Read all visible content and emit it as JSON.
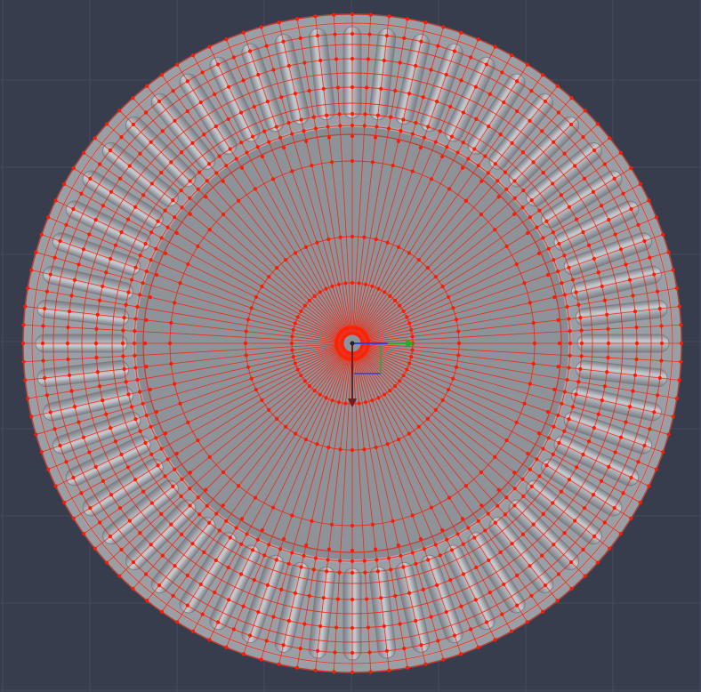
{
  "viewport": {
    "view": "top",
    "background_color": "#373d4d",
    "grid_line_color": "#454c5d"
  },
  "model": {
    "object": "plate",
    "surface_color": "#8e9299",
    "rim_color": "#9a9ea5",
    "flute_highlight_color": "#c9ccd1",
    "flute_count": 56,
    "radial_segment_count": 112,
    "wireframe_color": "#ff1a00",
    "vertex_color": "#ff1a00"
  },
  "gizmo": {
    "x_axis_color": "#2ea82e",
    "y_axis_color": "#3b3bd6",
    "z_axis_color": "#6b2020",
    "pivot_ring_color": "#ff2200"
  }
}
